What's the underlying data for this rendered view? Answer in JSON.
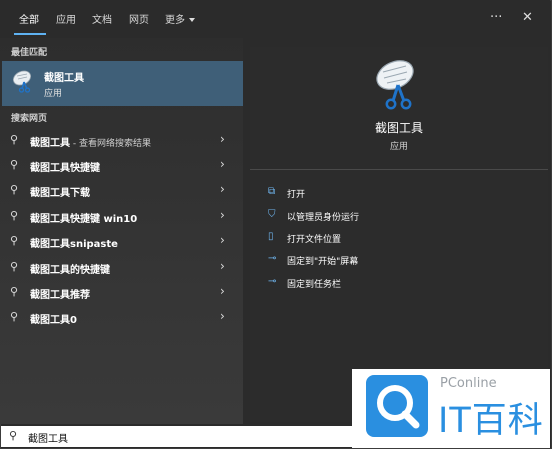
{
  "tabs": [
    {
      "label": "全部"
    },
    {
      "label": "应用"
    },
    {
      "label": "文档"
    },
    {
      "label": "网页"
    },
    {
      "label": "更多"
    }
  ],
  "top_icons": {
    "more": "more-icon",
    "close": "close-icon"
  },
  "sections": {
    "best_match": "最佳匹配",
    "web_search": "搜索网页"
  },
  "best_match": {
    "title": "截图工具",
    "subtitle": "应用",
    "icon": "snipping-tool-icon"
  },
  "web_results": [
    {
      "bold": "截图工具",
      "rest": " - 查看网络搜索结果"
    },
    {
      "bold": "截图工具快捷键",
      "rest": ""
    },
    {
      "bold": "截图工具下载",
      "rest": ""
    },
    {
      "bold": "截图工具快捷键 win10",
      "rest": ""
    },
    {
      "bold": "截图工具snipaste",
      "rest": ""
    },
    {
      "bold": "截图工具的快捷键",
      "rest": ""
    },
    {
      "bold": "截图工具推荐",
      "rest": ""
    },
    {
      "bold": "截图工具0",
      "rest": ""
    }
  ],
  "detail": {
    "title": "截图工具",
    "subtitle": "应用"
  },
  "actions": [
    {
      "label": "打开",
      "icon": "open-icon"
    },
    {
      "label": "以管理员身份运行",
      "icon": "admin-shield-icon"
    },
    {
      "label": "打开文件位置",
      "icon": "folder-icon"
    },
    {
      "label": "固定到\"开始\"屏幕",
      "icon": "pin-icon"
    },
    {
      "label": "固定到任务栏",
      "icon": "pin-icon"
    }
  ],
  "search": {
    "value": "截图工具"
  },
  "watermark": {
    "brand": "PConline",
    "name": "IT百科"
  },
  "colors": {
    "accent": "#5fb2f2",
    "best_match_bg": "#3f5f78",
    "watermark_blue": "#2a8fe0"
  }
}
